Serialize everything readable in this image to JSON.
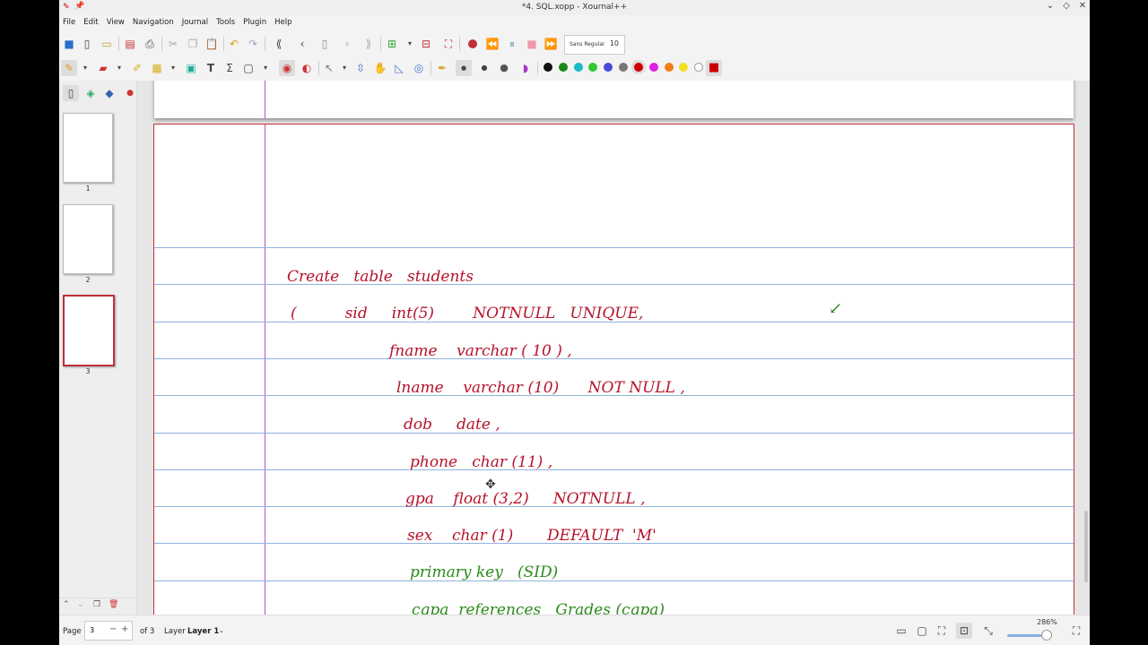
{
  "window": {
    "title": "*4. SQL.xopp - Xournal++"
  },
  "menu": [
    "File",
    "Edit",
    "View",
    "Navigation",
    "Journal",
    "Tools",
    "Plugin",
    "Help"
  ],
  "toolbar": {
    "font_name": "Sans Regular",
    "font_size": "10"
  },
  "colors": {
    "palette": [
      "#111111",
      "#1a8a1a",
      "#19b9c9",
      "#33c633",
      "#4a4ad8",
      "#777777",
      "#cc0000",
      "#e020e0",
      "#f07d18",
      "#f0e020",
      "#ffffff"
    ],
    "ink_red": "#b5122a",
    "ink_green": "#2a8a1a",
    "accent": "#c0303a"
  },
  "sidebar": {
    "pages": [
      "1",
      "2",
      "3"
    ],
    "selected": "3"
  },
  "page": {
    "lines": [
      {
        "t": "Create   table   students",
        "c": "red"
      },
      {
        "t": "(          sid     int(5)        NOTNULL   UNIQUE,",
        "c": "red"
      },
      {
        "t": "fname    varchar ( 10 ) ,",
        "c": "red"
      },
      {
        "t": "lname    varchar (10)      NOT NULL ,",
        "c": "red"
      },
      {
        "t": "dob     date ,",
        "c": "red"
      },
      {
        "t": "phone   char (11) ,",
        "c": "red"
      },
      {
        "t": "gpa    float (3,2)     NOTNULL ,",
        "c": "red"
      },
      {
        "t": "sex    char (1)       DEFAULT  'M'",
        "c": "red"
      },
      {
        "t": "primary key   (SID)",
        "c": "green"
      },
      {
        "t": "cgpa  references   Grades (cgpa)",
        "c": "green"
      }
    ],
    "annotation_arrow": "↙"
  },
  "status": {
    "page_label": "Page",
    "page_value": "3",
    "of_label": "of 3",
    "layer_label": "Layer",
    "layer_value": "Layer 1",
    "zoom": "286%"
  }
}
